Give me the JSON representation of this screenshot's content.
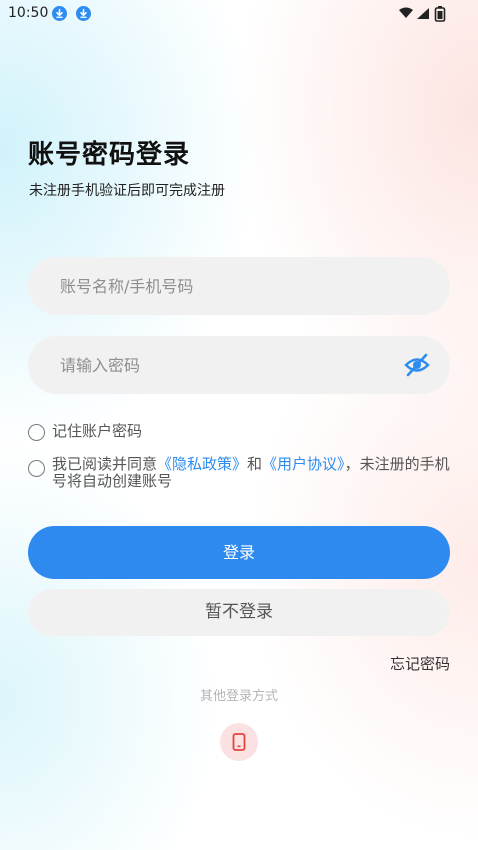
{
  "status_bar": {
    "time": "10:50"
  },
  "login": {
    "title": "账号密码登录",
    "subtitle": "未注册手机验证后即可完成注册",
    "account_placeholder": "账号名称/手机号码",
    "password_placeholder": "请输入密码",
    "remember_label": "记住账户密码",
    "agreement": {
      "prefix": "我已阅读并同意",
      "privacy_link": "《隐私政策》",
      "conjunction": "和",
      "user_link": "《用户协议》",
      "suffix": "，未注册的手机号将自动创建账号"
    },
    "login_button": "登录",
    "skip_button": "暂不登录",
    "forgot_password": "忘记密码",
    "other_methods": "其他登录方式"
  },
  "colors": {
    "accent": "#2f8af0",
    "link": "#2d8cf0",
    "field_bg": "#f1f1f1",
    "phone_icon_bg": "#fbe1e1",
    "phone_icon": "#e0443b"
  },
  "icons": {
    "download_1": "download-icon",
    "download_2": "download-icon",
    "wifi": "wifi-icon",
    "signal": "signal-icon",
    "battery": "battery-icon",
    "password_visibility": "eye-off-icon",
    "phone_login": "phone-icon"
  }
}
